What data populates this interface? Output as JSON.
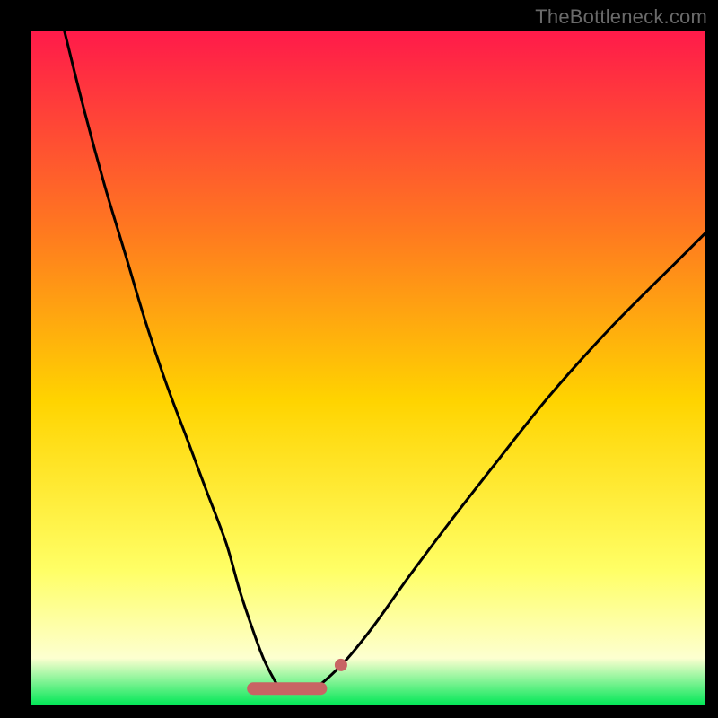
{
  "watermark": "TheBottleneck.com",
  "colors": {
    "frame": "#000000",
    "gradient_top": "#ff1a4a",
    "gradient_mid_upper": "#ff7a1f",
    "gradient_mid": "#ffd400",
    "gradient_mid_lower": "#ffff66",
    "gradient_pale": "#fdffd0",
    "gradient_green": "#00e756",
    "curve": "#000000",
    "marker": "#c86464"
  },
  "chart_data": {
    "type": "line",
    "title": "",
    "xlabel": "",
    "ylabel": "",
    "xlim": [
      0,
      100
    ],
    "ylim": [
      0,
      100
    ],
    "series": [
      {
        "name": "bottleneck-curve",
        "x": [
          5,
          8,
          11,
          14,
          17,
          20,
          23,
          26,
          29,
          31,
          33,
          34.5,
          36,
          37,
          38,
          40,
          42,
          44,
          47,
          51,
          56,
          62,
          69,
          77,
          86,
          96,
          100
        ],
        "y": [
          100,
          88,
          77,
          67,
          57,
          48,
          40,
          32,
          24,
          17,
          11,
          7,
          4,
          2.5,
          2,
          2,
          2.5,
          4,
          7,
          12,
          19,
          27,
          36,
          46,
          56,
          66,
          70
        ]
      }
    ],
    "markers": [
      {
        "name": "flat-marker-run",
        "x_from": 33,
        "x_to": 43,
        "y": 2.5
      },
      {
        "name": "isolated-marker",
        "x": 46,
        "y": 6
      }
    ],
    "annotations": []
  }
}
